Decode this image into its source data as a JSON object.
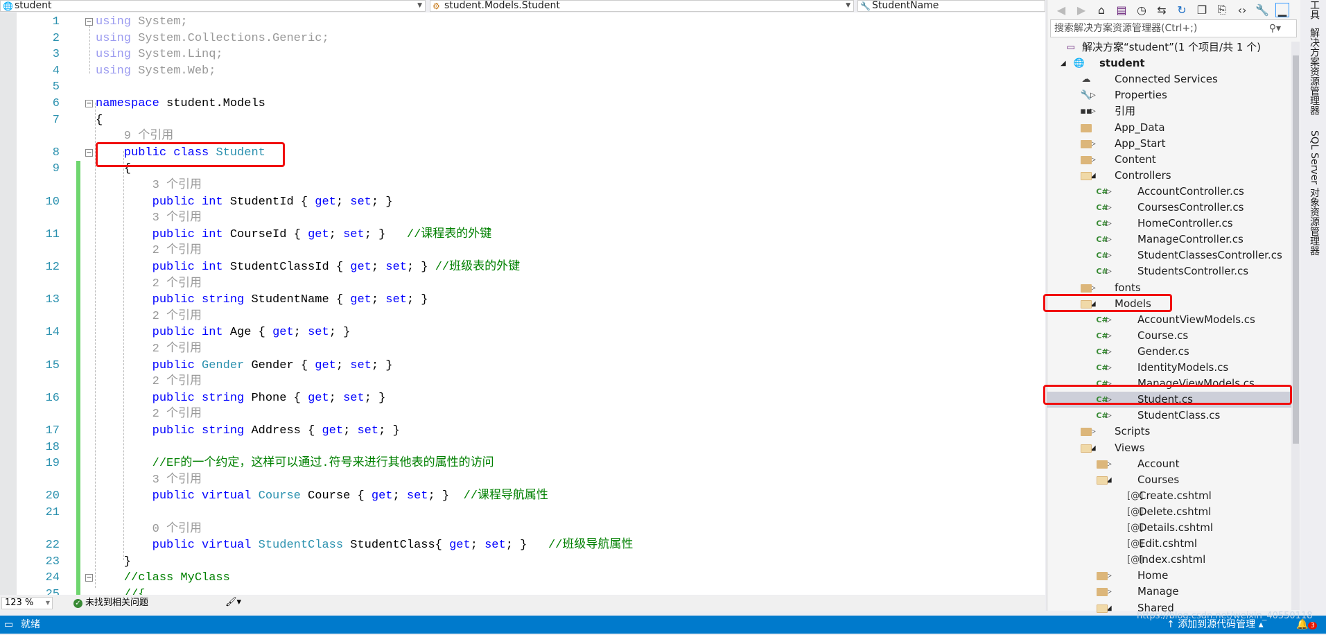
{
  "nav": {
    "project": "student",
    "class": "student.Models.Student",
    "member": "StudentName"
  },
  "editor": {
    "rows": [
      {
        "n": "1",
        "fold": "−",
        "tokens": [
          {
            "t": "using",
            "k": "faded-kw"
          },
          {
            "t": " System;",
            "k": "faded"
          }
        ]
      },
      {
        "n": "2",
        "tokens": [
          {
            "t": "using",
            "k": "faded-kw"
          },
          {
            "t": " System.Collections.Generic;",
            "k": "faded"
          }
        ]
      },
      {
        "n": "3",
        "tokens": [
          {
            "t": "using",
            "k": "faded-kw"
          },
          {
            "t": " System.Linq;",
            "k": "faded"
          }
        ]
      },
      {
        "n": "4",
        "tokens": [
          {
            "t": "using",
            "k": "faded-kw"
          },
          {
            "t": " System.Web;",
            "k": "faded"
          }
        ]
      },
      {
        "n": "5",
        "tokens": []
      },
      {
        "n": "6",
        "fold": "−",
        "tokens": [
          {
            "t": "namespace",
            "k": "keyword"
          },
          {
            "t": " student.Models",
            "k": "plain"
          }
        ]
      },
      {
        "n": "7",
        "tokens": [
          {
            "t": "{",
            "k": "plain"
          }
        ]
      },
      {
        "n": "",
        "tokens": [
          {
            "t": "    9 个引用",
            "k": "lens"
          }
        ]
      },
      {
        "n": "8",
        "fold": "−",
        "tokens": [
          {
            "t": "    public class ",
            "k": "keyword"
          },
          {
            "t": "Student",
            "k": "type"
          }
        ]
      },
      {
        "n": "9",
        "chg": true,
        "tokens": [
          {
            "t": "    {",
            "k": "plain"
          }
        ]
      },
      {
        "n": "",
        "chg": true,
        "tokens": [
          {
            "t": "        3 个引用",
            "k": "lens"
          }
        ]
      },
      {
        "n": "10",
        "chg": true,
        "tokens": [
          {
            "t": "        public int ",
            "k": "keyword"
          },
          {
            "t": "StudentId { ",
            "k": "plain"
          },
          {
            "t": "get",
            "k": "keyword"
          },
          {
            "t": "; ",
            "k": "plain"
          },
          {
            "t": "set",
            "k": "keyword"
          },
          {
            "t": "; }",
            "k": "plain"
          }
        ]
      },
      {
        "n": "",
        "chg": true,
        "tokens": [
          {
            "t": "        3 个引用",
            "k": "lens"
          }
        ]
      },
      {
        "n": "11",
        "chg": true,
        "tokens": [
          {
            "t": "        public int ",
            "k": "keyword"
          },
          {
            "t": "CourseId { ",
            "k": "plain"
          },
          {
            "t": "get",
            "k": "keyword"
          },
          {
            "t": "; ",
            "k": "plain"
          },
          {
            "t": "set",
            "k": "keyword"
          },
          {
            "t": "; }   ",
            "k": "plain"
          },
          {
            "t": "//课程表的外键",
            "k": "comment"
          }
        ]
      },
      {
        "n": "",
        "chg": true,
        "tokens": [
          {
            "t": "        2 个引用",
            "k": "lens"
          }
        ]
      },
      {
        "n": "12",
        "chg": true,
        "tokens": [
          {
            "t": "        public int ",
            "k": "keyword"
          },
          {
            "t": "StudentClassId { ",
            "k": "plain"
          },
          {
            "t": "get",
            "k": "keyword"
          },
          {
            "t": "; ",
            "k": "plain"
          },
          {
            "t": "set",
            "k": "keyword"
          },
          {
            "t": "; } ",
            "k": "plain"
          },
          {
            "t": "//班级表的外键",
            "k": "comment"
          }
        ]
      },
      {
        "n": "",
        "chg": true,
        "tokens": [
          {
            "t": "        2 个引用",
            "k": "lens"
          }
        ]
      },
      {
        "n": "13",
        "chg": true,
        "tokens": [
          {
            "t": "        public string ",
            "k": "keyword"
          },
          {
            "t": "StudentName { ",
            "k": "plain"
          },
          {
            "t": "get",
            "k": "keyword"
          },
          {
            "t": "; ",
            "k": "plain"
          },
          {
            "t": "set",
            "k": "keyword"
          },
          {
            "t": "; }",
            "k": "plain"
          }
        ]
      },
      {
        "n": "",
        "chg": true,
        "tokens": [
          {
            "t": "        2 个引用",
            "k": "lens"
          }
        ]
      },
      {
        "n": "14",
        "chg": true,
        "tokens": [
          {
            "t": "        public int ",
            "k": "keyword"
          },
          {
            "t": "Age { ",
            "k": "plain"
          },
          {
            "t": "get",
            "k": "keyword"
          },
          {
            "t": "; ",
            "k": "plain"
          },
          {
            "t": "set",
            "k": "keyword"
          },
          {
            "t": "; }",
            "k": "plain"
          }
        ]
      },
      {
        "n": "",
        "chg": true,
        "tokens": [
          {
            "t": "        2 个引用",
            "k": "lens"
          }
        ]
      },
      {
        "n": "15",
        "chg": true,
        "tokens": [
          {
            "t": "        public ",
            "k": "keyword"
          },
          {
            "t": "Gender",
            "k": "type"
          },
          {
            "t": " Gender { ",
            "k": "plain"
          },
          {
            "t": "get",
            "k": "keyword"
          },
          {
            "t": "; ",
            "k": "plain"
          },
          {
            "t": "set",
            "k": "keyword"
          },
          {
            "t": "; }",
            "k": "plain"
          }
        ]
      },
      {
        "n": "",
        "chg": true,
        "tokens": [
          {
            "t": "        2 个引用",
            "k": "lens"
          }
        ]
      },
      {
        "n": "16",
        "chg": true,
        "tokens": [
          {
            "t": "        public string ",
            "k": "keyword"
          },
          {
            "t": "Phone { ",
            "k": "plain"
          },
          {
            "t": "get",
            "k": "keyword"
          },
          {
            "t": "; ",
            "k": "plain"
          },
          {
            "t": "set",
            "k": "keyword"
          },
          {
            "t": "; }",
            "k": "plain"
          }
        ]
      },
      {
        "n": "",
        "chg": true,
        "tokens": [
          {
            "t": "        2 个引用",
            "k": "lens"
          }
        ]
      },
      {
        "n": "17",
        "chg": true,
        "tokens": [
          {
            "t": "        public string ",
            "k": "keyword"
          },
          {
            "t": "Address { ",
            "k": "plain"
          },
          {
            "t": "get",
            "k": "keyword"
          },
          {
            "t": "; ",
            "k": "plain"
          },
          {
            "t": "set",
            "k": "keyword"
          },
          {
            "t": "; }",
            "k": "plain"
          }
        ]
      },
      {
        "n": "18",
        "chg": true,
        "tokens": []
      },
      {
        "n": "19",
        "chg": true,
        "tokens": [
          {
            "t": "        //EF的一个约定，这样可以通过.符号来进行其他表的属性的访问",
            "k": "comment"
          }
        ]
      },
      {
        "n": "",
        "chg": true,
        "tokens": [
          {
            "t": "        3 个引用",
            "k": "lens"
          }
        ]
      },
      {
        "n": "20",
        "chg": true,
        "tokens": [
          {
            "t": "        public virtual ",
            "k": "keyword"
          },
          {
            "t": "Course",
            "k": "type"
          },
          {
            "t": " Course { ",
            "k": "plain"
          },
          {
            "t": "get",
            "k": "keyword"
          },
          {
            "t": "; ",
            "k": "plain"
          },
          {
            "t": "set",
            "k": "keyword"
          },
          {
            "t": "; }  ",
            "k": "plain"
          },
          {
            "t": "//课程导航属性",
            "k": "comment"
          }
        ]
      },
      {
        "n": "21",
        "chg": true,
        "tokens": []
      },
      {
        "n": "",
        "chg": true,
        "tokens": [
          {
            "t": "        0 个引用",
            "k": "lens"
          }
        ]
      },
      {
        "n": "22",
        "chg": true,
        "tokens": [
          {
            "t": "        public virtual ",
            "k": "keyword"
          },
          {
            "t": "StudentClass",
            "k": "type"
          },
          {
            "t": " StudentClass{ ",
            "k": "plain"
          },
          {
            "t": "get",
            "k": "keyword"
          },
          {
            "t": "; ",
            "k": "plain"
          },
          {
            "t": "set",
            "k": "keyword"
          },
          {
            "t": "; }   ",
            "k": "plain"
          },
          {
            "t": "//班级导航属性",
            "k": "comment"
          }
        ]
      },
      {
        "n": "23",
        "chg": true,
        "tokens": [
          {
            "t": "    }",
            "k": "plain"
          }
        ]
      },
      {
        "n": "24",
        "chg": true,
        "fold": "−",
        "tokens": [
          {
            "t": "    //class MyClass",
            "k": "comment"
          }
        ]
      },
      {
        "n": "25",
        "chg": true,
        "tokens": [
          {
            "t": "    //{",
            "k": "comment"
          }
        ]
      }
    ],
    "zoom": "123 %",
    "issues": "未找到相关问题"
  },
  "solution_explorer": {
    "search_placeholder": "搜索解决方案资源管理器(Ctrl+;)",
    "items": [
      {
        "label": "解决方案“student”(1 个项目/共 1 个)",
        "level": 0,
        "arrow": "",
        "icon": "solution"
      },
      {
        "label": "student",
        "level": 0,
        "arrow": "down",
        "icon": "project",
        "bold": true
      },
      {
        "label": "Connected Services",
        "level": 1,
        "arrow": "",
        "icon": "cloud"
      },
      {
        "label": "Properties",
        "level": 1,
        "arrow": "right",
        "icon": "wrench"
      },
      {
        "label": "引用",
        "level": 1,
        "arrow": "right",
        "icon": "reference"
      },
      {
        "label": "App_Data",
        "level": 1,
        "arrow": "",
        "icon": "folder"
      },
      {
        "label": "App_Start",
        "level": 1,
        "arrow": "right",
        "icon": "folder"
      },
      {
        "label": "Content",
        "level": 1,
        "arrow": "right",
        "icon": "folder"
      },
      {
        "label": "Controllers",
        "level": 1,
        "arrow": "down",
        "icon": "folder-open"
      },
      {
        "label": "AccountController.cs",
        "level": 2,
        "arrow": "right",
        "icon": "csharp"
      },
      {
        "label": "CoursesController.cs",
        "level": 2,
        "arrow": "right",
        "icon": "csharp"
      },
      {
        "label": "HomeController.cs",
        "level": 2,
        "arrow": "right",
        "icon": "csharp"
      },
      {
        "label": "ManageController.cs",
        "level": 2,
        "arrow": "right",
        "icon": "csharp"
      },
      {
        "label": "StudentClassesController.cs",
        "level": 2,
        "arrow": "right",
        "icon": "csharp"
      },
      {
        "label": "StudentsController.cs",
        "level": 2,
        "arrow": "right",
        "icon": "csharp"
      },
      {
        "label": "fonts",
        "level": 1,
        "arrow": "right",
        "icon": "folder"
      },
      {
        "label": "Models",
        "level": 1,
        "arrow": "down",
        "icon": "folder-open"
      },
      {
        "label": "AccountViewModels.cs",
        "level": 2,
        "arrow": "right",
        "icon": "csharp"
      },
      {
        "label": "Course.cs",
        "level": 2,
        "arrow": "right",
        "icon": "csharp"
      },
      {
        "label": "Gender.cs",
        "level": 2,
        "arrow": "right",
        "icon": "csharp"
      },
      {
        "label": "IdentityModels.cs",
        "level": 2,
        "arrow": "right",
        "icon": "csharp"
      },
      {
        "label": "ManageViewModels.cs",
        "level": 2,
        "arrow": "right",
        "icon": "csharp"
      },
      {
        "label": "Student.cs",
        "level": 2,
        "arrow": "right",
        "icon": "csharp",
        "selected": true
      },
      {
        "label": "StudentClass.cs",
        "level": 2,
        "arrow": "right",
        "icon": "csharp"
      },
      {
        "label": "Scripts",
        "level": 1,
        "arrow": "right",
        "icon": "folder"
      },
      {
        "label": "Views",
        "level": 1,
        "arrow": "down",
        "icon": "folder-open"
      },
      {
        "label": "Account",
        "level": 2,
        "arrow": "right",
        "icon": "folder"
      },
      {
        "label": "Courses",
        "level": 2,
        "arrow": "down",
        "icon": "folder-open"
      },
      {
        "label": "Create.cshtml",
        "level": 3,
        "arrow": "",
        "icon": "cshtml"
      },
      {
        "label": "Delete.cshtml",
        "level": 3,
        "arrow": "",
        "icon": "cshtml"
      },
      {
        "label": "Details.cshtml",
        "level": 3,
        "arrow": "",
        "icon": "cshtml"
      },
      {
        "label": "Edit.cshtml",
        "level": 3,
        "arrow": "",
        "icon": "cshtml"
      },
      {
        "label": "Index.cshtml",
        "level": 3,
        "arrow": "",
        "icon": "cshtml"
      },
      {
        "label": "Home",
        "level": 2,
        "arrow": "right",
        "icon": "folder"
      },
      {
        "label": "Manage",
        "level": 2,
        "arrow": "right",
        "icon": "folder"
      },
      {
        "label": "Shared",
        "level": 2,
        "arrow": "down",
        "icon": "folder-open"
      }
    ]
  },
  "side_tabs": {
    "toolbox": "工具",
    "solution_explorer": "解决方案资源管理器",
    "sql_server": "SQL Server 对象资源管理器"
  },
  "status": {
    "ready": "就绪",
    "source_control": "添加到源代码管理",
    "notifications": "3",
    "watermark": "https://blog.csdn.net/weixin_40550118"
  },
  "colors": {
    "statusbar": "#007acc",
    "keyword": "#0000ff",
    "type": "#2b91af",
    "comment": "#008000",
    "highlight": "#f01010"
  }
}
